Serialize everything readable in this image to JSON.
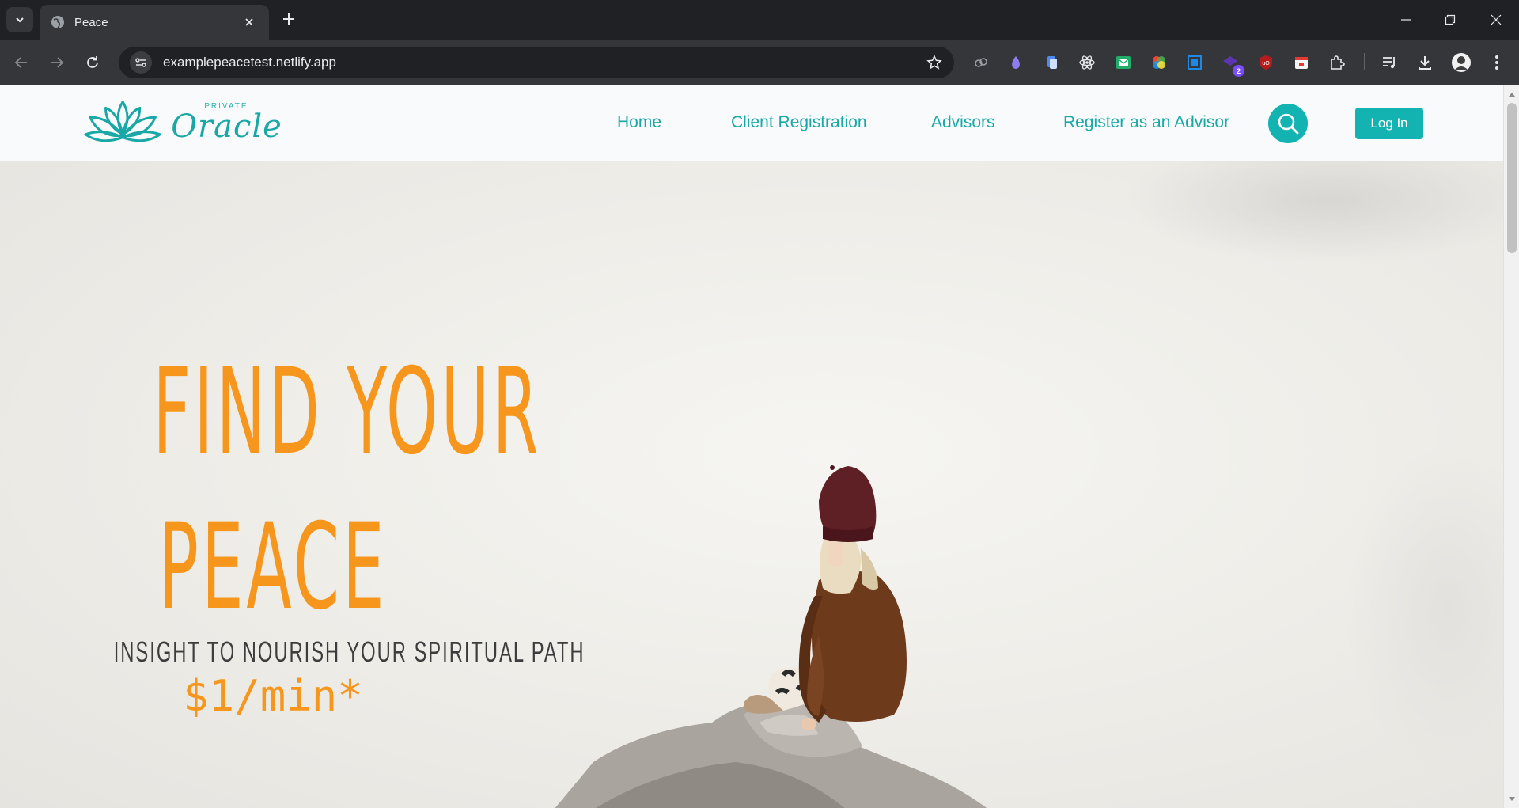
{
  "browser": {
    "tab_title": "Peace",
    "url": "examplepeacetest.netlify.app",
    "extension_badge": "2"
  },
  "site": {
    "logo": {
      "small_text": "PRIVATE",
      "main_text": "Oracle"
    },
    "nav": {
      "items": [
        {
          "label": "Home"
        },
        {
          "label": "Client Registration"
        },
        {
          "label": "Advisors"
        },
        {
          "label": "Register as an Advisor"
        }
      ],
      "login_label": "Log In"
    },
    "hero": {
      "headline_line1": "FIND YOUR",
      "headline_line2": "PEACE",
      "tagline": "INSIGHT TO NOURISH YOUR SPIRITUAL PATH",
      "price": "$1/min*"
    }
  },
  "colors": {
    "accent": "#12b3b1",
    "headline": "#f7961c",
    "chrome_dark": "#202124",
    "chrome_mid": "#35363a"
  }
}
